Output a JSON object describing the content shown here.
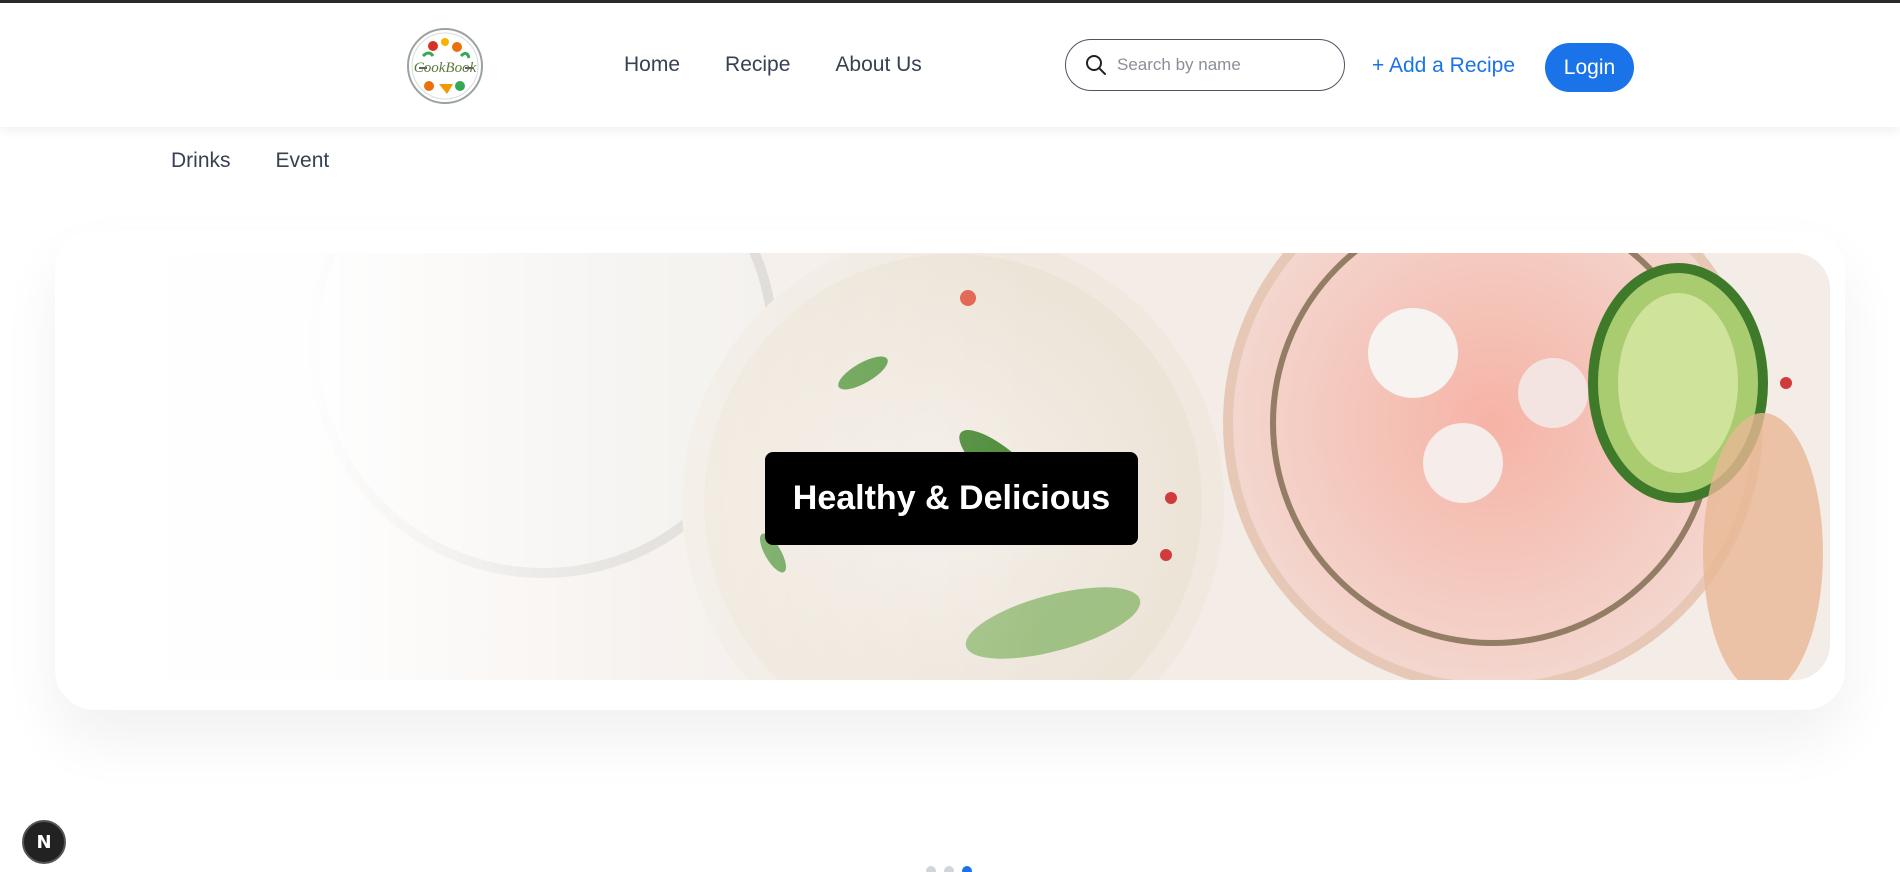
{
  "brand": {
    "logo_text": "CookBook"
  },
  "nav_main": [
    {
      "label": "Home"
    },
    {
      "label": "Recipe"
    },
    {
      "label": "About Us"
    }
  ],
  "search": {
    "placeholder": "Search by name",
    "value": "",
    "icon": "search-icon"
  },
  "actions": {
    "add_recipe": "+ Add a Recipe",
    "login": "Login"
  },
  "nav_sub": [
    {
      "label": "Drinks"
    },
    {
      "label": "Event"
    }
  ],
  "hero": {
    "caption": "Healthy & Delicious"
  },
  "carousel": {
    "slide_count": 3,
    "active_index": 2
  },
  "dev_badge": {
    "label": "N"
  },
  "colors": {
    "accent": "#1a73e8",
    "text": "#374151",
    "caption_bg": "#000000",
    "caption_text": "#ffffff"
  }
}
